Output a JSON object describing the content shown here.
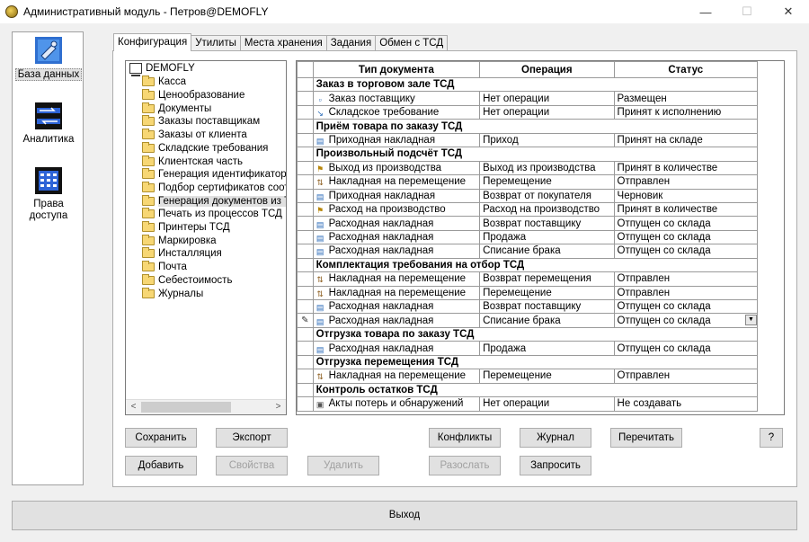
{
  "window": {
    "title": "Административный модуль - Петров@DEMOFLY",
    "minimize": "—",
    "maximize": "☐",
    "close": "✕"
  },
  "nav": {
    "items": [
      {
        "label": "База данных",
        "icon": "database-icon"
      },
      {
        "label": "Аналитика",
        "icon": "analytics-icon"
      },
      {
        "label": "Права доступа",
        "icon": "access-rights-icon"
      }
    ]
  },
  "tabs": [
    "Конфигурация",
    "Утилиты",
    "Места хранения",
    "Задания",
    "Обмен с ТСД"
  ],
  "tree": {
    "root": "DEMOFLY",
    "items": [
      "Касса",
      "Ценообразование",
      "Документы",
      "Заказы поставщикам",
      "Заказы от клиента",
      "Складские требования",
      "Клиентская часть",
      "Генерация идентификаторов",
      "Подбор сертификатов соответствия",
      "Генерация документов из ТСД",
      "Печать из процессов ТСД",
      "Принтеры ТСД",
      "Маркировка",
      "Инсталляция",
      "Почта",
      "Себестоимость",
      "Журналы"
    ],
    "selected_index": 9,
    "scroll_left": "<",
    "scroll_right": ">"
  },
  "grid": {
    "columns": [
      "Тип документа",
      "Операция",
      "Статус"
    ],
    "rows": [
      {
        "group": "Заказ в торговом зале ТСД"
      },
      {
        "doc": "Заказ поставщику",
        "op": "Нет операции",
        "status": "Размещен",
        "icon": "order-icon"
      },
      {
        "doc": "Складское требование",
        "op": "Нет операции",
        "status": "Принят к исполнению",
        "icon": "requirement-icon"
      },
      {
        "group": "Приём товара по заказу ТСД"
      },
      {
        "doc": "Приходная накладная",
        "op": "Приход",
        "status": "Принят на складе",
        "icon": "invoice-icon"
      },
      {
        "group": "Произвольный подсчёт ТСД"
      },
      {
        "doc": "Выход из производства",
        "op": "Выход из производства",
        "status": "Принят в количестве",
        "icon": "production-icon"
      },
      {
        "doc": "Накладная на перемещение",
        "op": "Перемещение",
        "status": "Отправлен",
        "icon": "transfer-icon"
      },
      {
        "doc": "Приходная накладная",
        "op": "Возврат от покупателя",
        "status": "Черновик",
        "icon": "invoice-icon"
      },
      {
        "doc": "Расход на производство",
        "op": "Расход на производство",
        "status": "Принят в количестве",
        "icon": "production-icon"
      },
      {
        "doc": "Расходная накладная",
        "op": "Возврат поставщику",
        "status": "Отпущен со склада",
        "icon": "invoice-icon"
      },
      {
        "doc": "Расходная накладная",
        "op": "Продажа",
        "status": "Отпущен со склада",
        "icon": "invoice-icon"
      },
      {
        "doc": "Расходная накладная",
        "op": "Списание брака",
        "status": "Отпущен со склада",
        "icon": "invoice-icon"
      },
      {
        "group": "Комплектация требования на отбор ТСД"
      },
      {
        "doc": "Накладная на перемещение",
        "op": "Возврат перемещения",
        "status": "Отправлен",
        "icon": "transfer-icon"
      },
      {
        "doc": "Накладная на перемещение",
        "op": "Перемещение",
        "status": "Отправлен",
        "icon": "transfer-icon"
      },
      {
        "doc": "Расходная накладная",
        "op": "Возврат поставщику",
        "status": "Отпущен со склада",
        "icon": "invoice-icon"
      },
      {
        "doc": "Расходная накладная",
        "op": "Списание брака",
        "status": "Отпущен со склада",
        "icon": "invoice-icon",
        "editing": true
      },
      {
        "group": "Отгрузка товара по заказу ТСД"
      },
      {
        "doc": "Расходная накладная",
        "op": "Продажа",
        "status": "Отпущен со склада",
        "icon": "invoice-icon"
      },
      {
        "group": "Отгрузка перемещения ТСД"
      },
      {
        "doc": "Накладная на перемещение",
        "op": "Перемещение",
        "status": "Отправлен",
        "icon": "transfer-icon"
      },
      {
        "group": "Контроль остатков ТСД"
      },
      {
        "doc": "Акты потерь и обнаружений",
        "op": "Нет операции",
        "status": "Не создавать",
        "icon": "act-icon"
      }
    ]
  },
  "buttons": {
    "save": "Сохранить",
    "export": "Экспорт",
    "conflicts": "Конфликты",
    "journal": "Журнал",
    "reread": "Перечитать",
    "help": "?",
    "add": "Добавить",
    "properties": "Свойства",
    "delete": "Удалить",
    "send": "Разослать",
    "request": "Запросить",
    "exit": "Выход"
  }
}
